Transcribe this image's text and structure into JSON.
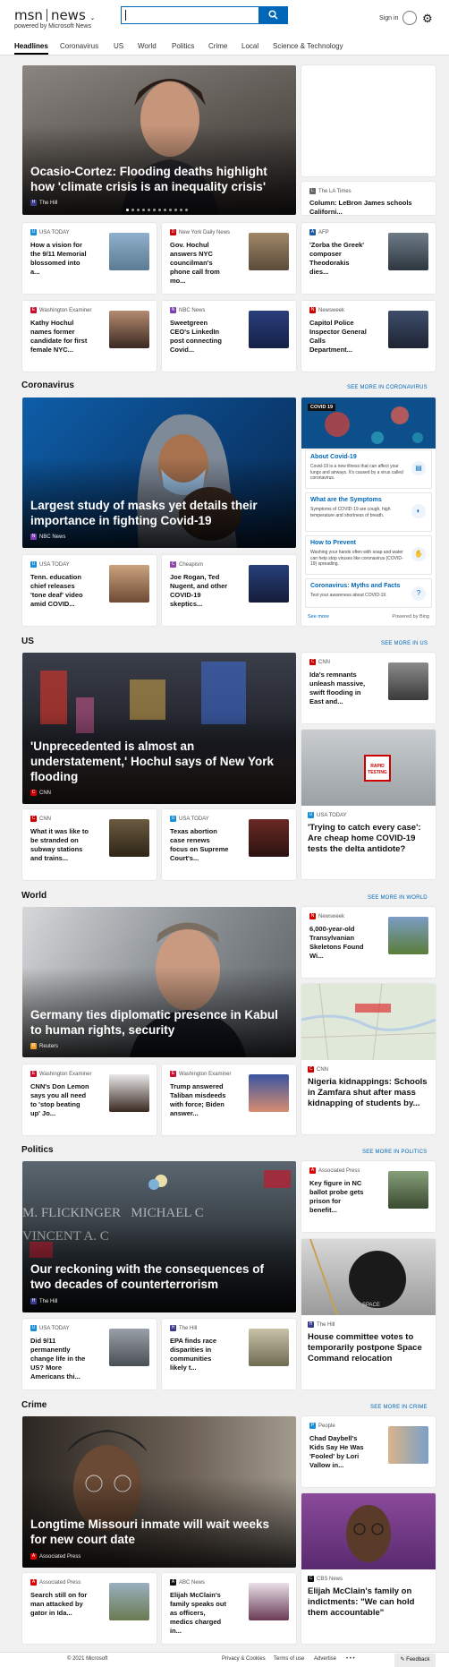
{
  "header": {
    "brand_msn": "msn",
    "brand_news": "news",
    "powered": "powered by Microsoft News",
    "signin": "Sign in"
  },
  "nav": [
    "Headlines",
    "Coronavirus",
    "US",
    "World",
    "Politics",
    "Crime",
    "Local",
    "Science & Technology"
  ],
  "top": {
    "hero_title": "Ocasio-Cortez: Flooding deaths highlight how 'climate crisis is an inequality crisis'",
    "hero_source": "The Hill",
    "side_source": "The LA Times",
    "side_title": "Column: LeBron James schools Californi...",
    "cards": [
      {
        "source": "USA TODAY",
        "title": "How a vision for the 9/11 Memorial blossomed into a..."
      },
      {
        "source": "New York Daily News",
        "title": "Gov. Hochul answers NYC councilman's phone call from mo..."
      },
      {
        "source": "AFP",
        "title": "'Zorba the Greek' composer Theodorakis dies..."
      },
      {
        "source": "Washington Examiner",
        "title": "Kathy Hochul names former candidate for first female NYC..."
      },
      {
        "source": "NBC News",
        "title": "Sweetgreen CEO's LinkedIn post connecting Covid..."
      },
      {
        "source": "Newsweek",
        "title": "Capitol Police Inspector General Calls Department..."
      }
    ]
  },
  "coronavirus": {
    "label": "Coronavirus",
    "see_more": "SEE MORE IN CORONAVIRUS",
    "hero_title": "Largest study of masks yet details their importance in fighting Covid-19",
    "hero_source": "NBC News",
    "cards": [
      {
        "source": "USA TODAY",
        "title": "Tenn. education chief releases 'tone deaf' video amid COVID..."
      },
      {
        "source": "Cheapism",
        "title": "Joe Rogan, Ted Nugent, and other COVID-19 skeptics..."
      }
    ],
    "widget": {
      "badge": "COVID 19",
      "items": [
        {
          "title": "About Covid-19",
          "body": "Covid-19 is a new illness that can affect your lungs and airways. It's caused by a virus called coronavirus."
        },
        {
          "title": "What are the Symptoms",
          "body": "Symptoms of COVID-19 are cough, high temperature and shortness of breath."
        },
        {
          "title": "How to Prevent",
          "body": "Washing your hands often with soap and water can help stop viruses like coronavirus (COVID-19) spreading."
        },
        {
          "title": "Coronavirus: Myths and Facts",
          "body": "Test your awareness about COVID-19."
        }
      ],
      "see_more": "See more",
      "powered": "Powered by Bing"
    }
  },
  "us": {
    "label": "US",
    "see_more": "SEE MORE IN US",
    "hero_title": "'Unprecedented is almost an understatement,' Hochul says of New York flooding",
    "hero_source": "CNN",
    "cards": [
      {
        "source": "CNN",
        "title": "Ida's remnants unleash massive, swift flooding in East and..."
      },
      {
        "source": "CNN",
        "title": "What it was like to be stranded on subway stations and trains..."
      },
      {
        "source": "USA TODAY",
        "title": "Texas abortion case renews focus on Supreme Court's..."
      }
    ],
    "big": {
      "source": "USA TODAY",
      "title": "'Trying to catch every case': Are cheap home COVID-19 tests the delta antidote?",
      "img_text": "RAPID TESTING"
    }
  },
  "world": {
    "label": "World",
    "see_more": "SEE MORE IN WORLD",
    "hero_title": "Germany ties diplomatic presence in Kabul to human rights, security",
    "hero_source": "Reuters",
    "cards": [
      {
        "source": "Newsweek",
        "title": "6,000-year-old Transylvanian Skeletons Found Wi..."
      },
      {
        "source": "Washington Examiner",
        "title": "CNN's Don Lemon says you all need to 'stop beating up' Jo..."
      },
      {
        "source": "Washington Examiner",
        "title": "Trump answered Taliban misdeeds with force; Biden answer..."
      }
    ],
    "big": {
      "source": "CNN",
      "title": "Nigeria kidnappings: Schools in Zamfara shut after mass kidnapping of students by..."
    }
  },
  "politics": {
    "label": "Politics",
    "see_more": "SEE MORE IN POLITICS",
    "hero_title": "Our reckoning with the consequences of two decades of counterterrorism",
    "hero_source": "The Hill",
    "hero_img_text": "M. FLICKINGER   MICHAEL C\nVINCENT A. C",
    "cards": [
      {
        "source": "Associated Press",
        "title": "Key figure in NC ballot probe gets prison for benefit..."
      },
      {
        "source": "USA TODAY",
        "title": "Did 9/11 permanently change life in the US? More Americans thi..."
      },
      {
        "source": "The Hill",
        "title": "EPA finds race disparities in communities likely t..."
      }
    ],
    "big": {
      "source": "The Hill",
      "title": "House committee votes to temporarily postpone Space Command relocation",
      "img_text": "SPACE"
    }
  },
  "crime": {
    "label": "Crime",
    "see_more": "SEE MORE IN CRIME",
    "hero_title": "Longtime Missouri inmate will wait weeks for new court date",
    "hero_source": "Associated Press",
    "cards": [
      {
        "source": "People",
        "title": "Chad Daybell's Kids Say He Was 'Fooled' by Lori Vallow in..."
      },
      {
        "source": "Associated Press",
        "title": "Search still on for man attacked by gator in Ida..."
      },
      {
        "source": "ABC News",
        "title": "Elijah McClain's family speaks out as officers, medics charged in..."
      }
    ],
    "big": {
      "source": "CBS News",
      "title": "Elijah McClain's family on indictments: \"We can hold them accountable\""
    }
  },
  "footer": {
    "copyright": "© 2021 Microsoft",
    "privacy": "Privacy & Cookies",
    "terms": "Terms of use",
    "advertise": "Advertise",
    "more": "• • •",
    "feedback": "Feedback"
  }
}
